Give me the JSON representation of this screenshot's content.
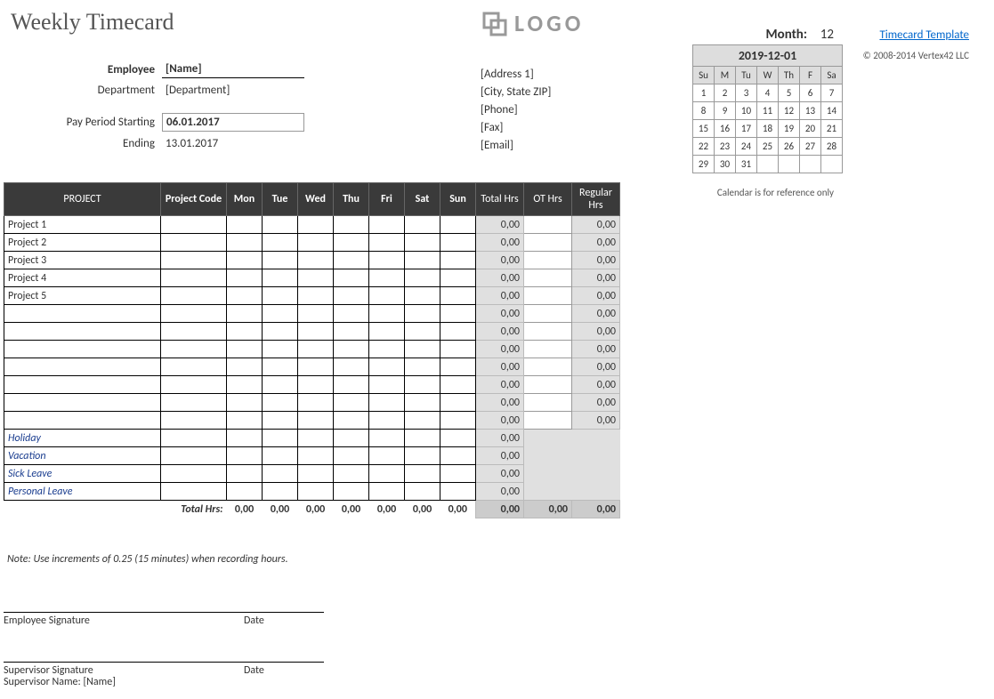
{
  "title": "Weekly Timecard",
  "logo_text": "LOGO",
  "month_label": "Month:",
  "month_value": "12",
  "link_text": "Timecard Template",
  "copyright": "© 2008-2014 Vertex42 LLC",
  "info": {
    "employee_label": "Employee",
    "employee_value": "[Name]",
    "department_label": "Department",
    "department_value": "[Department]",
    "start_label": "Pay Period Starting",
    "start_value": "06.01.2017",
    "end_label": "Ending",
    "end_value": "13.01.2017"
  },
  "address": {
    "line1": "[Address 1]",
    "line2": "[City, State  ZIP]",
    "line3": "[Phone]",
    "line4": "[Fax]",
    "line5": "[Email]"
  },
  "calendar": {
    "title": "2019-12-01",
    "days": [
      "Su",
      "M",
      "Tu",
      "W",
      "Th",
      "F",
      "Sa"
    ],
    "weeks": [
      [
        "1",
        "2",
        "3",
        "4",
        "5",
        "6",
        "7"
      ],
      [
        "8",
        "9",
        "10",
        "11",
        "12",
        "13",
        "14"
      ],
      [
        "15",
        "16",
        "17",
        "18",
        "19",
        "20",
        "21"
      ],
      [
        "22",
        "23",
        "24",
        "25",
        "26",
        "27",
        "28"
      ],
      [
        "29",
        "30",
        "31",
        "",
        "",
        "",
        ""
      ]
    ],
    "note": "Calendar is for reference only"
  },
  "table": {
    "headers": {
      "project": "PROJECT",
      "code": "Project Code",
      "days": [
        "Mon",
        "Tue",
        "Wed",
        "Thu",
        "Fri",
        "Sat",
        "Sun"
      ],
      "total": "Total Hrs",
      "ot": "OT Hrs",
      "regular": "Regular Hrs"
    },
    "projects": [
      "Project 1",
      "Project 2",
      "Project 3",
      "Project 4",
      "Project 5",
      "",
      "",
      "",
      "",
      "",
      "",
      ""
    ],
    "leave_rows": [
      "Holiday",
      "Vacation",
      "Sick Leave",
      "Personal Leave"
    ],
    "zero": "0,00",
    "total_label": "Total Hrs:"
  },
  "note": "Note: Use increments of 0.25 (15 minutes) when recording hours.",
  "signatures": {
    "emp": "Employee Signature",
    "date": "Date",
    "sup": "Supervisor Signature",
    "sup_name_label": "Supervisor Name:",
    "sup_name_value": "[Name]"
  }
}
